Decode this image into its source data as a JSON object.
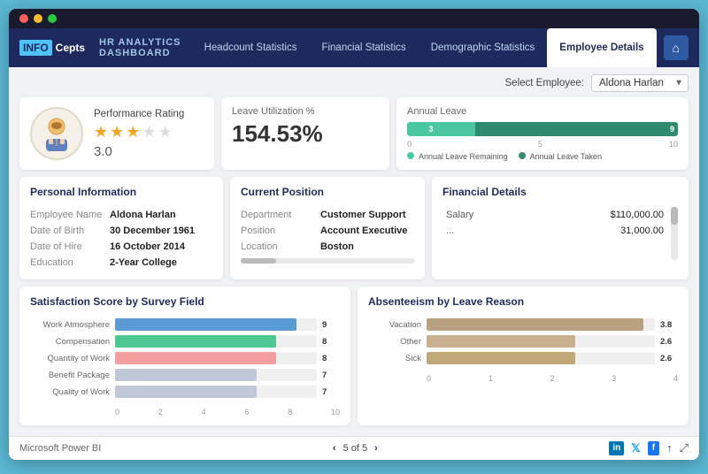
{
  "window": {
    "dots": [
      "red",
      "yellow",
      "green"
    ]
  },
  "nav": {
    "logo_info": "INFO",
    "logo_cepts": "Cepts",
    "subtitle": "HR ANALYTICS DASHBOARD",
    "tabs": [
      {
        "label": "Headcount Statistics",
        "active": false
      },
      {
        "label": "Financial Statistics",
        "active": false
      },
      {
        "label": "Demographic Statistics",
        "active": false
      },
      {
        "label": "Employee Details",
        "active": true
      }
    ],
    "home_icon": "⌂"
  },
  "employee_selector": {
    "label": "Select Employee:",
    "value": "Aldona Harlan"
  },
  "performance": {
    "title": "Performance Rating",
    "rating": 3.0,
    "rating_display": "3.0",
    "stars": [
      true,
      true,
      true,
      false,
      false
    ]
  },
  "leave": {
    "title": "Leave Utilization %",
    "value": "154.53%"
  },
  "annual_leave": {
    "title": "Annual Leave",
    "remaining_label": "3",
    "taken_label": "9",
    "remaining_pct": 25,
    "taken_pct": 75,
    "axis": [
      "0",
      "5",
      "10"
    ],
    "legend_remaining": "Annual Leave Remaining",
    "legend_taken": "Annual Leave Taken"
  },
  "personal": {
    "section_title": "Personal Information",
    "fields": [
      {
        "label": "Employee Name",
        "value": "Aldona Harlan"
      },
      {
        "label": "Date of Birth",
        "value": "30 December 1961"
      },
      {
        "label": "Date of Hire",
        "value": "16 October 2014"
      },
      {
        "label": "Education",
        "value": "2-Year College"
      }
    ]
  },
  "position": {
    "section_title": "Current Position",
    "fields": [
      {
        "label": "Department",
        "value": "Customer Support"
      },
      {
        "label": "Position",
        "value": "Account Executive"
      },
      {
        "label": "Location",
        "value": "Boston"
      }
    ]
  },
  "financial": {
    "section_title": "Financial Details",
    "fields": [
      {
        "label": "Salary",
        "value": "$110,000.00"
      },
      {
        "label": "...",
        "value": "31,000.00"
      }
    ]
  },
  "satisfaction": {
    "title": "Satisfaction Score by Survey Field",
    "bars": [
      {
        "label": "Work Atmosphere",
        "value": 9,
        "max": 10,
        "color": "#5b9bd5"
      },
      {
        "label": "Compensation",
        "value": 8,
        "max": 10,
        "color": "#4ec994"
      },
      {
        "label": "Quantity of Work",
        "value": 8,
        "max": 10,
        "color": "#f4a0a0"
      },
      {
        "label": "Benefit Package",
        "value": 7,
        "max": 10,
        "color": "#c0c8d8"
      },
      {
        "label": "Quality of Work",
        "value": 7,
        "max": 10,
        "color": "#c0c8d8"
      }
    ],
    "axis": [
      "0",
      "2",
      "4",
      "6",
      "8",
      "10"
    ]
  },
  "absenteeism": {
    "title": "Absenteeism by Leave Reason",
    "bars": [
      {
        "label": "Vacation",
        "value": 3.8,
        "max": 4,
        "color": "#b8a080"
      },
      {
        "label": "Other",
        "value": 2.6,
        "max": 4,
        "color": "#c8b090"
      },
      {
        "label": "Sick",
        "value": 2.6,
        "max": 4,
        "color": "#c0a878"
      }
    ],
    "axis": [
      "0",
      "1",
      "2",
      "3",
      "4"
    ]
  },
  "footer": {
    "brand": "Microsoft Power BI",
    "page_current": "5",
    "page_total": "5",
    "icons": [
      "in",
      "𝕏",
      "f",
      "↑",
      "⤢"
    ]
  }
}
